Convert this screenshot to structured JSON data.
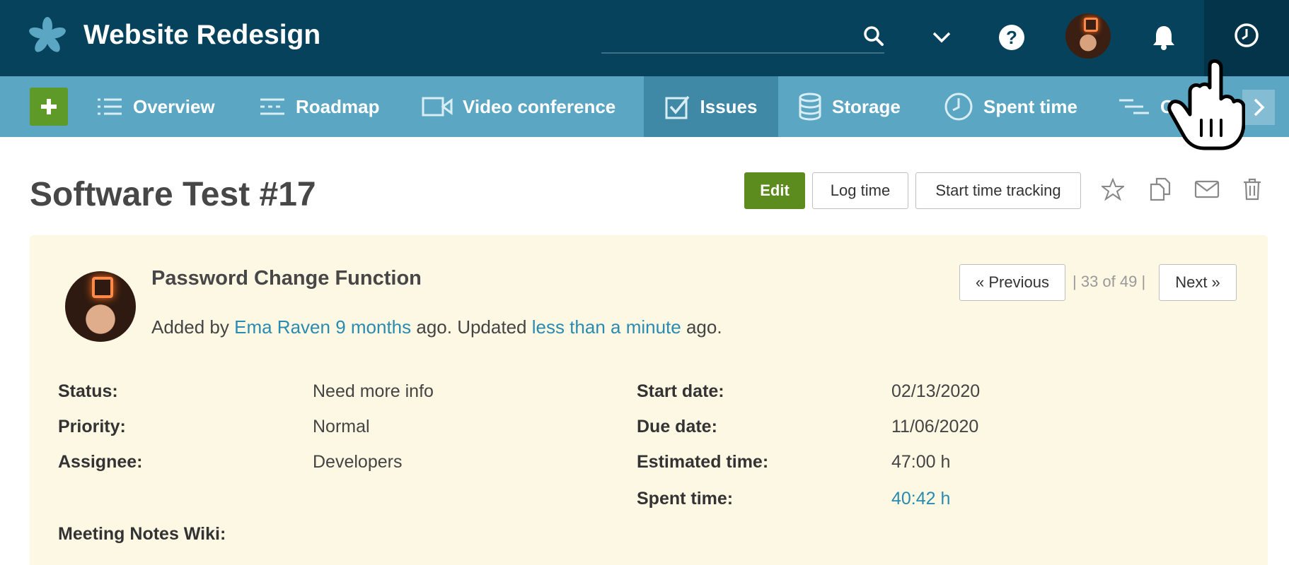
{
  "header": {
    "project_title": "Website Redesign",
    "search": {
      "placeholder": "",
      "value": ""
    },
    "icons": [
      "logo-icon",
      "search-icon",
      "chevron-down-icon",
      "help-icon",
      "avatar",
      "bell-icon",
      "clock-icon"
    ]
  },
  "nav": {
    "items": [
      {
        "label": "Overview",
        "icon": "list-icon"
      },
      {
        "label": "Roadmap",
        "icon": "roadmap-icon"
      },
      {
        "label": "Video conference",
        "icon": "video-icon"
      },
      {
        "label": "Issues",
        "icon": "checkbox-icon",
        "active": true
      },
      {
        "label": "Storage",
        "icon": "database-icon"
      },
      {
        "label": "Spent time",
        "icon": "clock-icon"
      },
      {
        "label": "G",
        "icon": "gantt-icon"
      }
    ]
  },
  "issue": {
    "title": "Software Test #17",
    "actions": {
      "edit": "Edit",
      "log_time": "Log time",
      "start_tracking": "Start time tracking"
    },
    "subject": "Password Change Function",
    "meta": {
      "added_by": "Added by",
      "author": "Ema Raven",
      "added_ago": "9 months",
      "ago_updated": " ago. Updated ",
      "updated_ago": "less than a minute",
      "ago_end": " ago."
    },
    "pager": {
      "previous": "« Previous",
      "count": "| 33 of 49 |",
      "next": "Next »"
    },
    "attributes_left": [
      {
        "label": "Status:",
        "value": "Need more info"
      },
      {
        "label": "Priority:",
        "value": "Normal"
      },
      {
        "label": "Assignee:",
        "value": "Developers"
      }
    ],
    "attributes_right": [
      {
        "label": "Start date:",
        "value": "02/13/2020"
      },
      {
        "label": "Due date:",
        "value": "11/06/2020"
      },
      {
        "label": "Estimated time:",
        "value": "47:00 h"
      },
      {
        "label": "Spent time:",
        "value": "40:42 h"
      }
    ],
    "wiki_label": "Meeting Notes Wiki:"
  },
  "colors": {
    "header_bg": "#06425b",
    "nav_bg": "#5ba6c2",
    "nav_active": "#3f89a6",
    "primary_green": "#5d8c1e",
    "panel_bg": "#fdf8e4",
    "link": "#2b8ab0"
  }
}
